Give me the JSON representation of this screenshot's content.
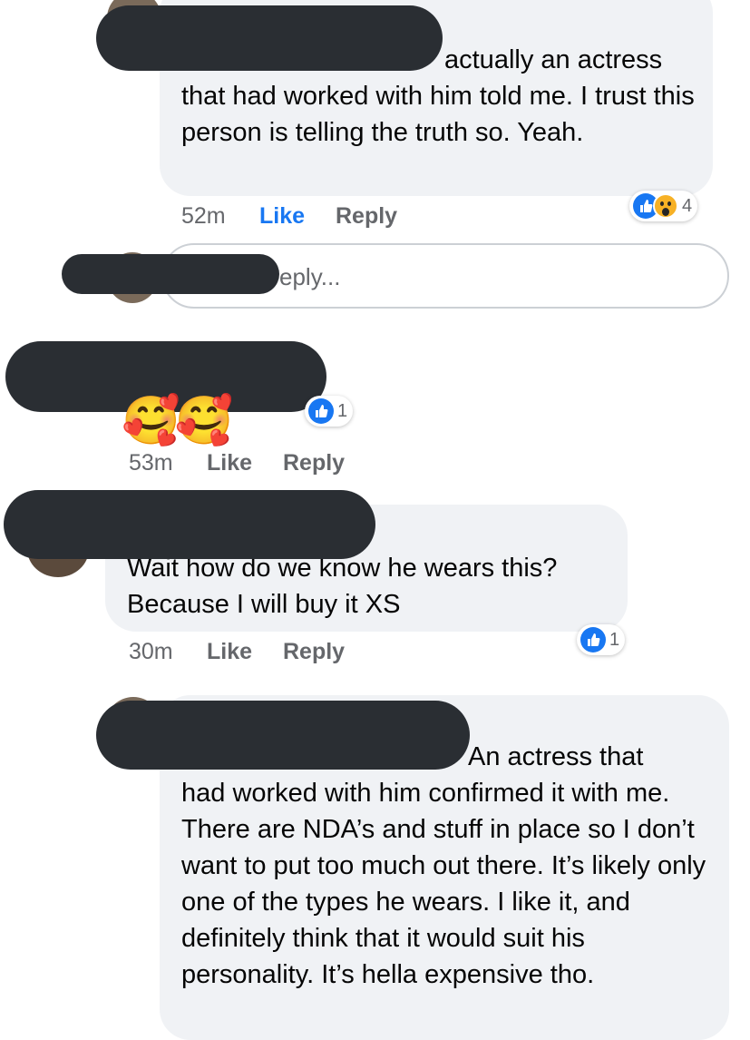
{
  "comments": [
    {
      "text_line1_tail": "actually an actress",
      "text_rest": "that had worked with him told me. I trust this person is telling the truth so. Yeah.",
      "time": "52m",
      "like": "Like",
      "reply": "Reply",
      "reaction_count": "4",
      "reactions": [
        "like-icon",
        "wow-icon"
      ]
    },
    {
      "time": "53m",
      "like": "Like",
      "reply": "Reply",
      "reaction_count": "1",
      "emoji": "🥰🥰"
    },
    {
      "text": "Wait how do we know he wears this? Because I will buy it XS",
      "time": "30m",
      "like": "Like",
      "reply": "Reply",
      "reaction_count": "1"
    },
    {
      "text_line1_tail": "An actress that",
      "text_rest": "had worked with him confirmed it with me. There are NDA’s and stuff in place so I don’t want to put too much out there. It’s likely only one of the types he wears. I like it, and definitely think that it would suit his personality. It’s hella expensive tho."
    }
  ],
  "reply_box": {
    "placeholder_tail": "eply..."
  },
  "colors": {
    "accent": "#1877f2",
    "bubble": "#f0f2f5",
    "redaction": "#2a2e33"
  }
}
